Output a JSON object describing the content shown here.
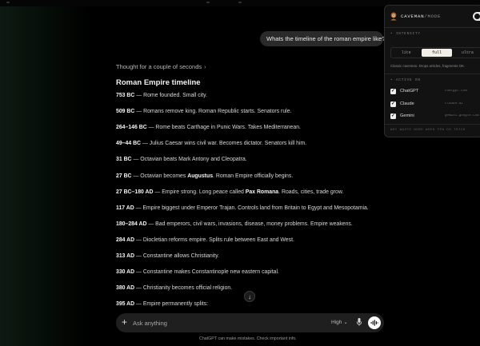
{
  "conversation": {
    "user_message": "Whats the timeline of the roman empire like?",
    "thought_label": "Thought for a couple of seconds",
    "thought_chevron": "›",
    "answer_title": "Roman Empire timeline",
    "entries": [
      {
        "date": "753 BC",
        "text": " — Rome founded. Small city."
      },
      {
        "date": "509 BC",
        "text": " — Romans remove king. Roman Republic starts. Senators rule."
      },
      {
        "date": "264–146 BC",
        "text": " — Rome beats Carthage in Punic Wars. Takes Mediterranean."
      },
      {
        "date": "49–44 BC",
        "text": " — Julius Caesar wins civil war. Becomes dictator. Senators kill him."
      },
      {
        "date": "31 BC",
        "text": " — Octavian beats Mark Antony and Cleopatra."
      },
      {
        "date": "27 BC",
        "text_before": " — Octavian becomes ",
        "bold": "Augustus",
        "text_after": ". Roman Empire officially begins."
      },
      {
        "date": "27 BC–180 AD",
        "text_before": " — Empire strong. Long peace called ",
        "bold": "Pax Romana",
        "text_after": ". Roads, cities, trade grow."
      },
      {
        "date": "117 AD",
        "text": " — Empire biggest under Emperor Trajan. Controls land from Britain to Egypt and Mesopotamia."
      },
      {
        "date": "180–284 AD",
        "text": " — Bad emperors, civil wars, invasions, disease, money problems. Empire weakens."
      },
      {
        "date": "284 AD",
        "text": " — Diocletian reforms empire. Splits rule between East and West."
      },
      {
        "date": "313 AD",
        "text": " — Constantine allows Christianity."
      },
      {
        "date": "330 AD",
        "text": " — Constantine makes Constantinople new eastern capital."
      },
      {
        "date": "380 AD",
        "text": " — Christianity becomes official religion."
      },
      {
        "date": "395 AD",
        "text": " — Empire permanently splits:"
      }
    ]
  },
  "composer": {
    "plus_label": "+",
    "placeholder": "Ask anything",
    "model_label": "High",
    "model_chevron": "⌄",
    "scroll_down_glyph": "↓"
  },
  "footer_note": "ChatGPT can make mistakes. Check important info.",
  "extension_panel": {
    "brand_main": "CAVEMAN",
    "brand_sep": "/",
    "brand_sub": "MODE",
    "enabled": true,
    "intensity_label": "• INTENSITY",
    "intensity_options": [
      "lite",
      "full",
      "ultra"
    ],
    "intensity_selected": "full",
    "intensity_hint": "Classic caveman. Drops articles, fragments OK.",
    "active_label": "• ACTIVE ON",
    "sites": [
      {
        "name": "ChatGPT",
        "domain": "chatgpt.com",
        "checked": true
      },
      {
        "name": "Claude",
        "domain": "claude.ai",
        "checked": true
      },
      {
        "name": "Gemini",
        "domain": "gemini.google.com",
        "checked": true
      }
    ],
    "tagline": "WHY WASTE WORD WHEN FEW DO TRICK"
  },
  "colors": {
    "background": "#000000",
    "user_bubble": "#2a2a2a",
    "composer": "#1f1f1f",
    "panel_bg": "#121212",
    "segment_selected": "#f1efe6"
  }
}
